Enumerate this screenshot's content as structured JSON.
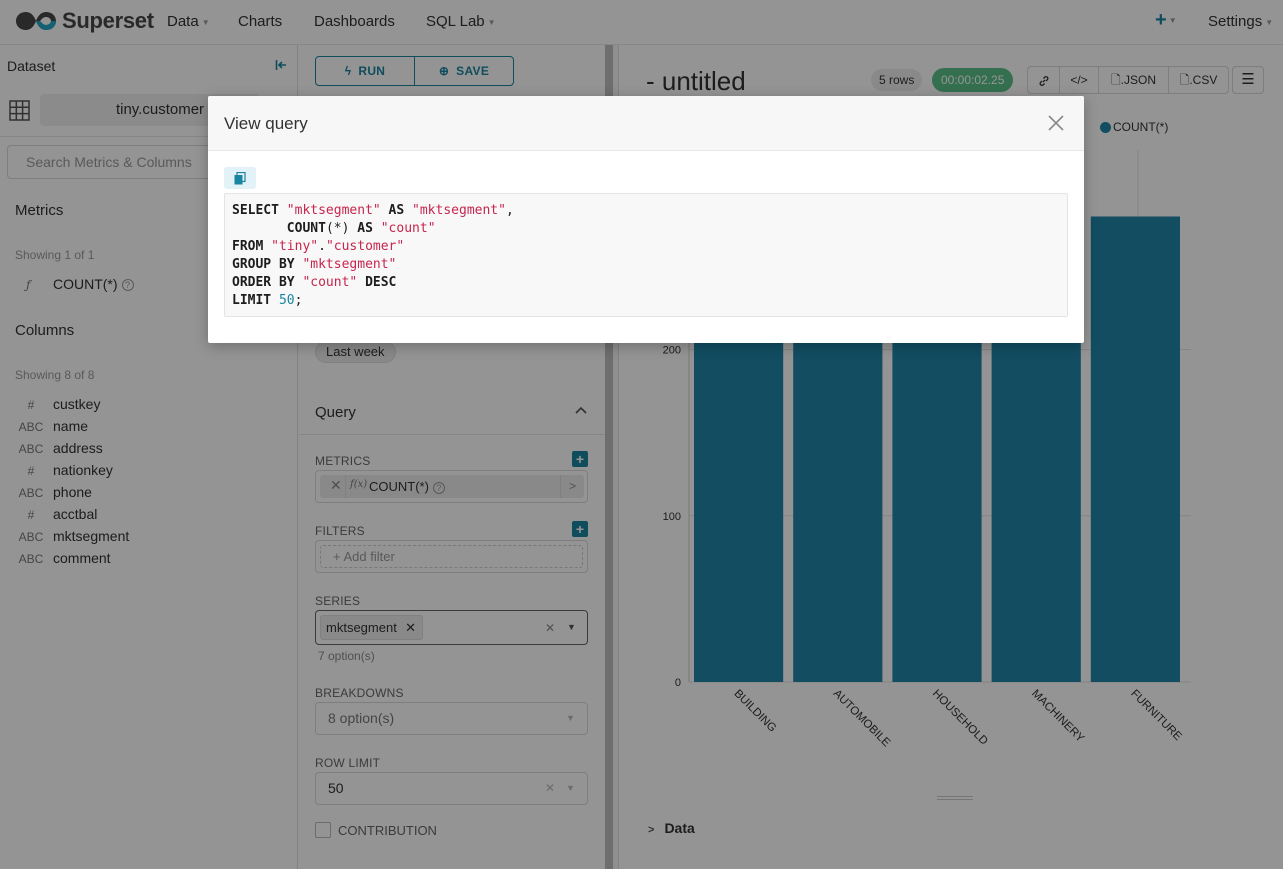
{
  "nav": {
    "brand": "Superset",
    "items": [
      {
        "label": "Data",
        "has_caret": true
      },
      {
        "label": "Charts",
        "has_caret": false
      },
      {
        "label": "Dashboards",
        "has_caret": false
      },
      {
        "label": "SQL Lab",
        "has_caret": true
      }
    ],
    "plus": "+",
    "settings": "Settings"
  },
  "dataset_panel": {
    "title": "Dataset",
    "dataset_name": "tiny.customer",
    "search_placeholder": "Search Metrics & Columns",
    "metrics_heading": "Metrics",
    "metrics_showing": "Showing 1 of 1",
    "metrics": [
      {
        "prefix": "ƒ",
        "name": "COUNT(*)"
      }
    ],
    "columns_heading": "Columns",
    "columns_showing": "Showing 8 of 8",
    "columns": [
      {
        "type": "#",
        "name": "custkey"
      },
      {
        "type": "ABC",
        "name": "name"
      },
      {
        "type": "ABC",
        "name": "address"
      },
      {
        "type": "#",
        "name": "nationkey"
      },
      {
        "type": "ABC",
        "name": "phone"
      },
      {
        "type": "#",
        "name": "acctbal"
      },
      {
        "type": "ABC",
        "name": "mktsegment"
      },
      {
        "type": "ABC",
        "name": "comment"
      }
    ]
  },
  "controls": {
    "run_label": "RUN",
    "save_label": "SAVE",
    "time_range_chip": "Last week",
    "query_heading": "Query",
    "metrics_label": "METRICS",
    "metric_chip": "COUNT(*)",
    "metric_chip_prefix": "f(x)",
    "filters_label": "FILTERS",
    "add_filter": "Add filter",
    "series_label": "SERIES",
    "series_chip": "mktsegment",
    "series_hint": "7 option(s)",
    "breakdowns_label": "BREAKDOWNS",
    "breakdowns_placeholder": "8 option(s)",
    "row_limit_label": "ROW LIMIT",
    "row_limit_value": "50",
    "contribution_label": "CONTRIBUTION"
  },
  "chart_panel": {
    "title": "- untitled",
    "rows_badge": "5 rows",
    "timer": "00:00:02.25",
    "json_btn": ".JSON",
    "csv_btn": ".CSV",
    "data_toggle": "Data"
  },
  "chart_data": {
    "type": "bar",
    "categories": [
      "BUILDING",
      "AUTOMOBILE",
      "HOUSEHOLD",
      "MACHINERY",
      "FURNITURE"
    ],
    "series": [
      {
        "name": "COUNT(*)",
        "values": [
          310,
          310,
          310,
          310,
          280
        ]
      }
    ],
    "yticks": [
      0,
      100,
      200
    ],
    "ylim": [
      0,
      320
    ],
    "color": "#1f86a9",
    "legend_position": "top-right",
    "grid": true
  },
  "modal": {
    "title": "View query",
    "sql_lines": [
      [
        {
          "t": "kw",
          "v": "SELECT"
        },
        {
          "t": "txt",
          "v": " "
        },
        {
          "t": "str",
          "v": "\"mktsegment\""
        },
        {
          "t": "txt",
          "v": " "
        },
        {
          "t": "kw",
          "v": "AS"
        },
        {
          "t": "txt",
          "v": " "
        },
        {
          "t": "str",
          "v": "\"mktsegment\""
        },
        {
          "t": "txt",
          "v": ","
        }
      ],
      [
        {
          "t": "txt",
          "v": "       "
        },
        {
          "t": "kw",
          "v": "COUNT"
        },
        {
          "t": "txt",
          "v": "(*) "
        },
        {
          "t": "kw",
          "v": "AS"
        },
        {
          "t": "txt",
          "v": " "
        },
        {
          "t": "str",
          "v": "\"count\""
        }
      ],
      [
        {
          "t": "kw",
          "v": "FROM"
        },
        {
          "t": "txt",
          "v": " "
        },
        {
          "t": "str",
          "v": "\"tiny\""
        },
        {
          "t": "txt",
          "v": "."
        },
        {
          "t": "str",
          "v": "\"customer\""
        }
      ],
      [
        {
          "t": "kw",
          "v": "GROUP BY"
        },
        {
          "t": "txt",
          "v": " "
        },
        {
          "t": "str",
          "v": "\"mktsegment\""
        }
      ],
      [
        {
          "t": "kw",
          "v": "ORDER BY"
        },
        {
          "t": "txt",
          "v": " "
        },
        {
          "t": "str",
          "v": "\"count\""
        },
        {
          "t": "txt",
          "v": " "
        },
        {
          "t": "kw",
          "v": "DESC"
        }
      ],
      [
        {
          "t": "kw",
          "v": "LIMIT"
        },
        {
          "t": "txt",
          "v": " "
        },
        {
          "t": "num",
          "v": "50"
        },
        {
          "t": "txt",
          "v": ";"
        }
      ]
    ]
  }
}
